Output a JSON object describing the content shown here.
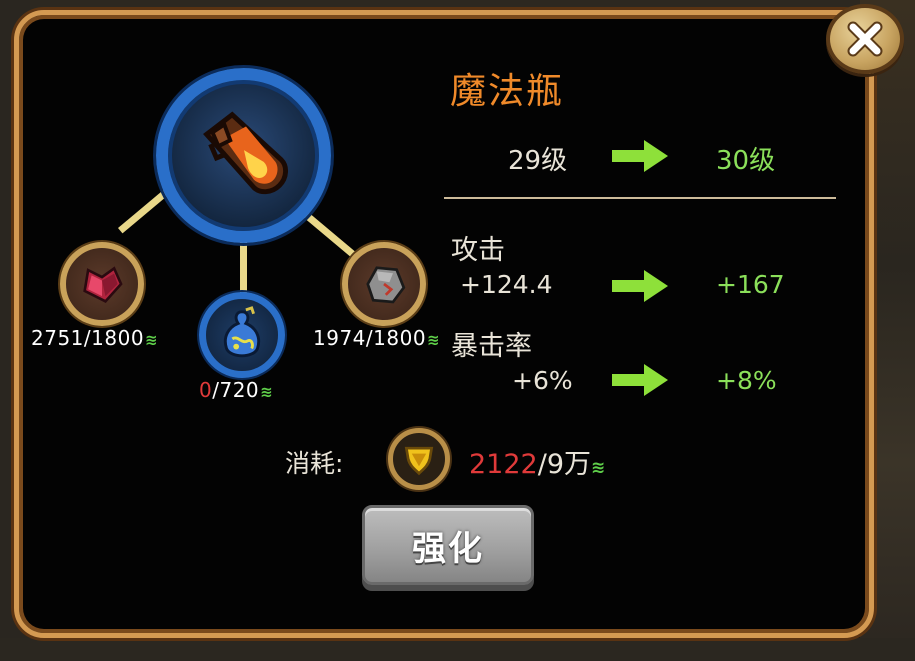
{
  "item": {
    "name": "魔法瓶",
    "level_current": "29级",
    "level_next": "30级"
  },
  "stats": [
    {
      "label": "攻击",
      "current": "+124.4",
      "next": "+167"
    },
    {
      "label": "暴击率",
      "current": "+6%",
      "next": "+8%"
    }
  ],
  "materials": [
    {
      "icon": "red-gem-icon",
      "have": "2751",
      "need": "/1800"
    },
    {
      "icon": "blue-gourd-icon",
      "have": "0",
      "need": "/720"
    },
    {
      "icon": "stone-ore-icon",
      "have": "1974",
      "need": "/1800"
    }
  ],
  "cost": {
    "label": "消耗:",
    "icon": "gold-shield-coin-icon",
    "have": "2122",
    "need": "/9万"
  },
  "buttons": {
    "strengthen": "强化",
    "close": "close-icon"
  },
  "colors": {
    "title": "#f08a2a",
    "upgrade_value": "#8be05a",
    "arrow": "#8ee03a",
    "insufficient": "#e03a3a",
    "frame": "#d49a52"
  }
}
